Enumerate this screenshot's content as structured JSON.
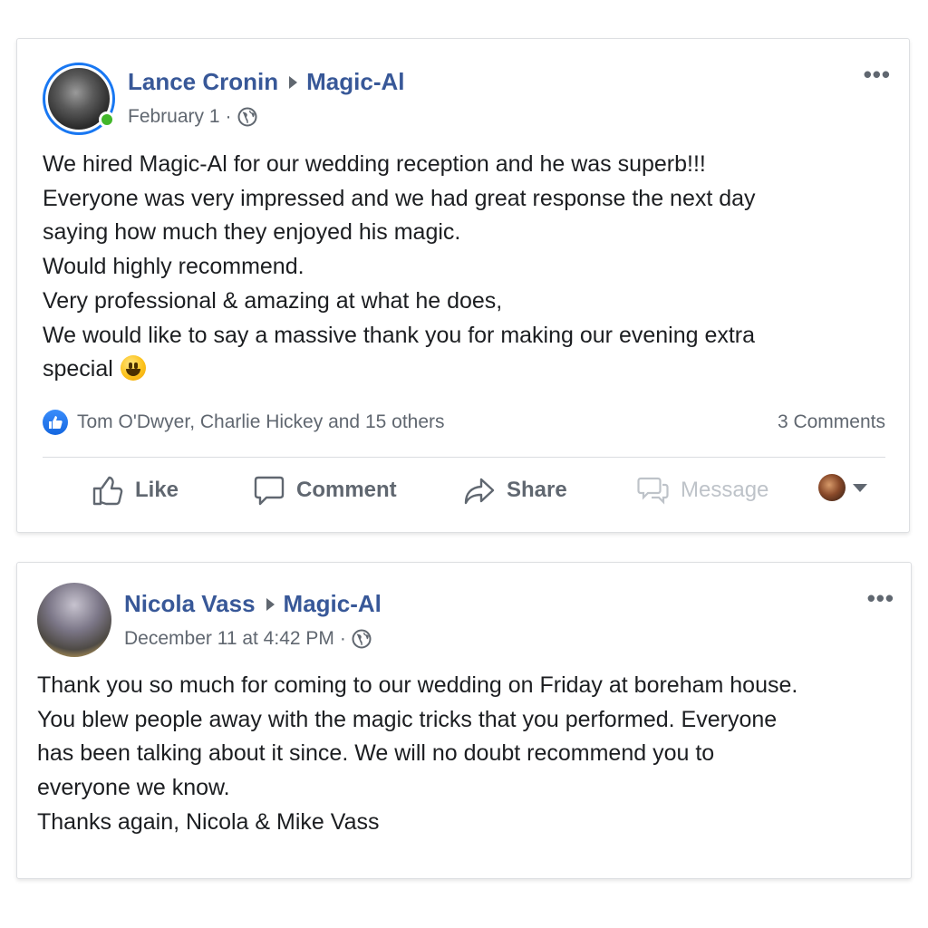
{
  "posts": [
    {
      "author": "Lance Cronin",
      "page": "Magic-Al",
      "date": "February 1",
      "separator": "·",
      "body_lines": [
        "We hired Magic-Al for our wedding reception and he was superb!!!",
        "Everyone was very impressed and we had great response the next day",
        "saying how much they enjoyed his magic.",
        "Would highly recommend.",
        "Very professional & amazing at what he does,",
        "We would like to say a massive thank you for making our evening extra",
        "special"
      ],
      "body_emoji": "grinning-face-emoji",
      "reactions_text": "Tom O'Dwyer, Charlie Hickey and 15 others",
      "comments_count": "3 Comments",
      "actions": {
        "like": "Like",
        "comment": "Comment",
        "share": "Share",
        "message": "Message"
      },
      "more_label": "•••",
      "icons": [
        "globe-icon",
        "like-icon",
        "comment-icon",
        "share-icon",
        "message-icon",
        "caret-down-icon",
        "more-icon"
      ]
    },
    {
      "author": "Nicola Vass",
      "page": "Magic-Al",
      "date": "December 11 at 4:42 PM",
      "separator": "·",
      "body_lines": [
        "Thank you so much for coming to our wedding on Friday at boreham house.",
        "You blew people away with the magic tricks that you performed. Everyone",
        "has been talking about it since. We will no doubt recommend you to",
        "everyone we know.",
        "Thanks again, Nicola & Mike Vass"
      ],
      "more_label": "•••"
    }
  ],
  "colors": {
    "name_link": "#385898",
    "meta_text": "#606770",
    "like_blue": "#1877f2",
    "online_green": "#42b72a",
    "disabled_text": "#bec3c9"
  }
}
